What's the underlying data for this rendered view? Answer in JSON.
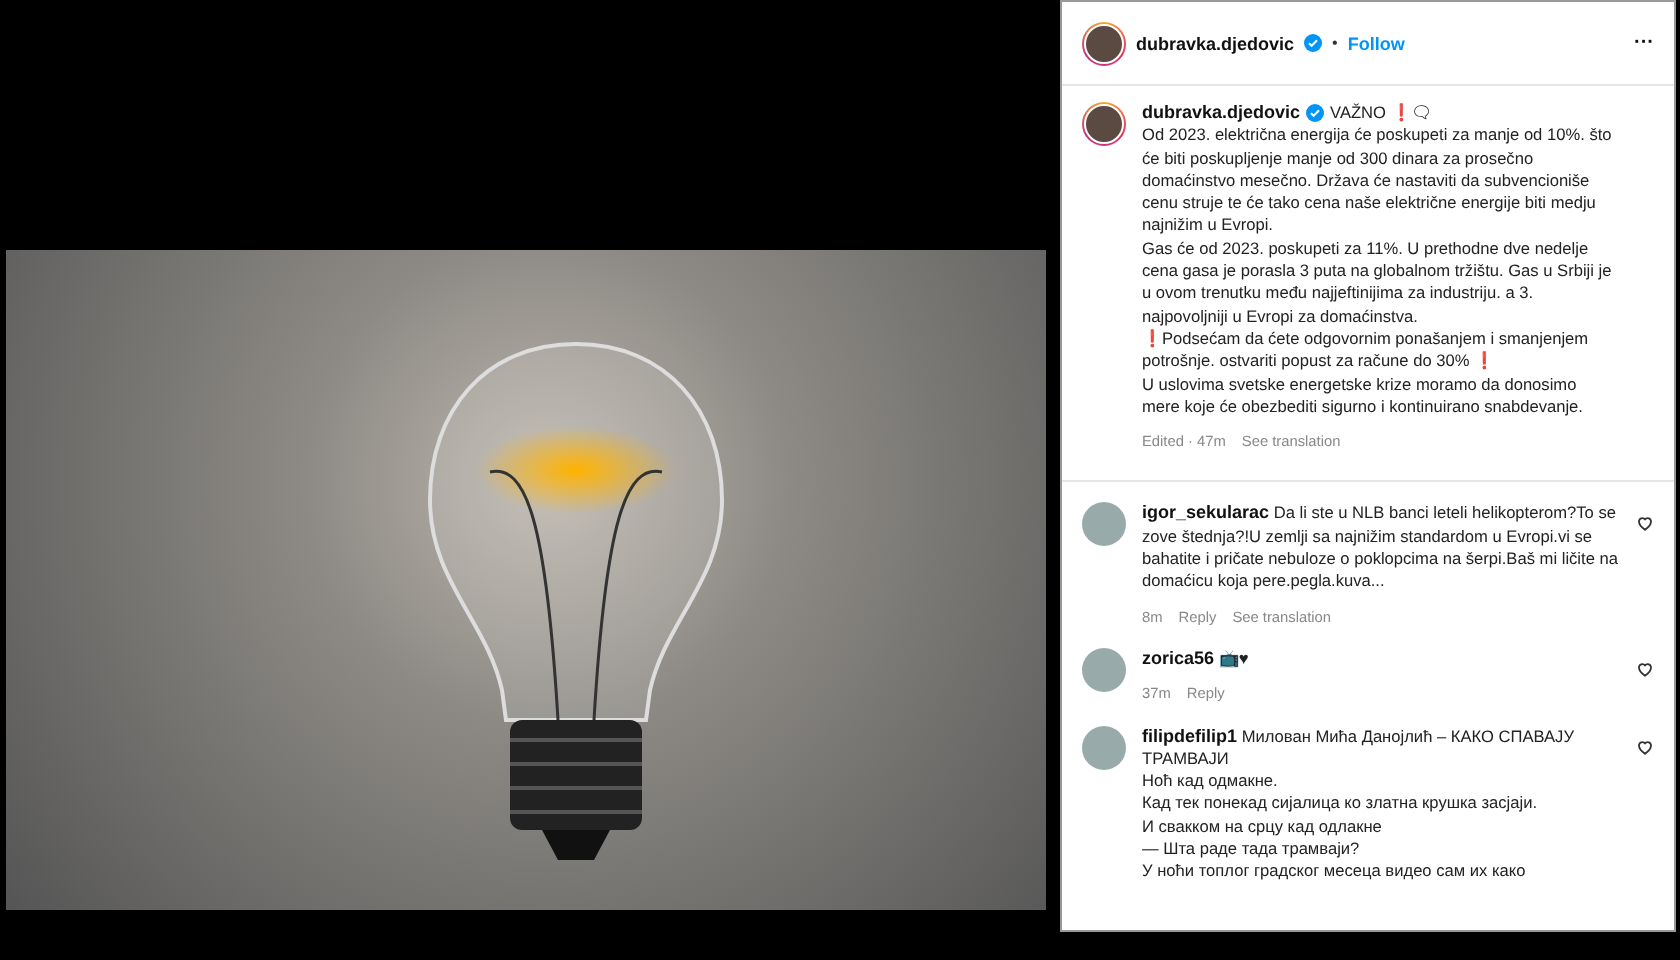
{
  "post_header": {
    "username": "dubravka.djedovic",
    "separator": "•",
    "follow": "Follow",
    "more": "···"
  },
  "caption": {
    "username": "dubravka.djedovic",
    "headline": "VAŽNO ❗🗨",
    "paragraphs": [
      "Od 2023. električna energija će poskupeti za manje od 10%. što će biti poskupljenje manje od 300 dinara za prosečno domaćinstvo mesečno. Država će nastaviti da subvencioniše cenu struje te će tako cena naše električne energije biti medju najnižim u Evropi.",
      "Gas će od 2023. poskupeti za 11%. U prethodne dve nedelje cena gasa je porasla 3 puta na globalnom tržištu. Gas u Srbiji je u ovom trenutku među najjeftinijima za industriju. a 3. najpovoljniji u Evropi za domaćinstva.",
      "❗Podsećam da ćete odgovornim ponašanjem i smanjenjem potrošnje. ostvariti popust za račune do 30% ❗",
      "U uslovima svetske energetske krize moramo da donosimo mere koje će obezbediti sigurno i kontinuirano snabdevanje."
    ],
    "time": "Edited · 47m",
    "see_translation": "See translation"
  },
  "comments": [
    {
      "username": "igor_sekularac",
      "lines": [
        "Da li ste u NLB banci leteli helikopterom?To se zove štednja?!U zemlji sa najnižim standardom u Evropi.vi se bahatite i pričate nebuloze o poklopcima na šerpi.Baš mi ličite na domaćicu koja pere.pegla.kuva..."
      ],
      "time": "8m",
      "actions": [
        "Reply",
        "See translation"
      ]
    },
    {
      "username": "zorica56",
      "lines": [
        "📺♥"
      ],
      "time": "37m",
      "actions": [
        "Reply"
      ]
    },
    {
      "username": "filipdefilip1",
      "lines": [
        "Милован Мића Данојлић – КАКО СПАВАЈУ ТРАМВАЈИ",
        "Ноћ кад одмакне.",
        "Кад тек понекад сијалица ко златна крушка засјаји.",
        "И свакком на срцу кад одлакне",
        "— Шта раде тада трамваји?",
        "У ноћи топлог градског месеца видео сам их како"
      ]
    }
  ]
}
